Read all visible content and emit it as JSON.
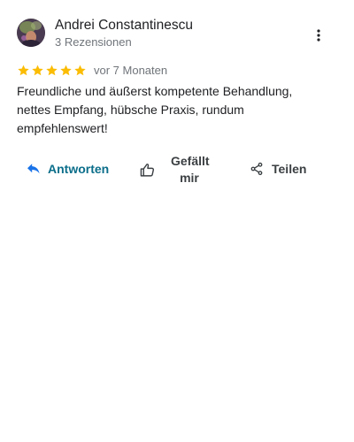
{
  "review": {
    "author_name": "Andrei Constantinescu",
    "review_count": "3 Rezensionen",
    "rating": 5,
    "rating_max": 5,
    "time": "vor 7 Monaten",
    "text": "Freundliche und äußerst kompetente Behandlung, nettes Empfang, hübsche Praxis, rundum empfehlenswert!"
  },
  "actions": {
    "reply_label": "Antworten",
    "like_label": "Gefällt mir",
    "share_label": "Teilen"
  },
  "icons": {
    "avatar": "avatar-photo",
    "more": "more-vert-icon",
    "star": "star-icon",
    "reply": "reply-icon",
    "like": "thumb-up-icon",
    "share": "share-icon"
  },
  "colors": {
    "star": "#fbbc04",
    "reply_accent": "#1a73e8",
    "secondary_text": "#70757a"
  }
}
